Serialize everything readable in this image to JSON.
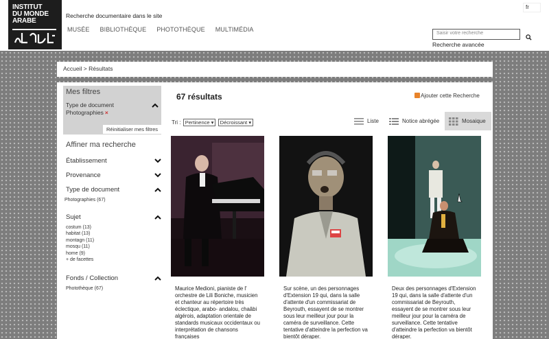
{
  "header": {
    "logo_text": "INSTITUT\nDU MONDE\nARABE",
    "tagline": "Recherche documentaire dans le site",
    "nav": [
      "MUSÉE",
      "BIBLIOTHÈQUE",
      "PHOTOTHÈQUE",
      "MULTIMÉDIA"
    ],
    "lang": "fr",
    "search_placeholder": "Saisir votre recherche",
    "advanced_search": "Recherche avancée"
  },
  "breadcrumb": "Accueil > Résultats",
  "sidebar": {
    "filters_title": "Mes filtres",
    "active_filter_label": "Type de document",
    "active_filter_value": "Photographies",
    "remove_symbol": "×",
    "reset_label": "Réinitialiser mes filtres",
    "refine_title": "Affiner ma recherche",
    "facets": {
      "etablissement": "Établissement",
      "provenance": "Provenance",
      "type_document": "Type de document",
      "type_items": [
        "Photographies (67)"
      ],
      "sujet": "Sujet",
      "sujet_items": [
        "costum (13)",
        "habitat (13)",
        "montagn (11)",
        "mosqu (11)",
        "home (9)",
        "+ de facettes"
      ],
      "fonds": "Fonds / Collection",
      "fonds_items": [
        "Photothèque (67)"
      ]
    }
  },
  "results": {
    "count_label": "67 résultats",
    "rss_label": "Ajouter cette Recherche",
    "sort_label": "Tri :",
    "sort_field": "Pertinence",
    "sort_order": "Décroissant",
    "view_list": "Liste",
    "view_short": "Notice abrégée",
    "view_mosaic": "Mosaique"
  },
  "cards": [
    {
      "icon": "pianist-photo",
      "caption": "Maurice Medioni, pianiste de l' orchestre de Lili Boniche, musicien et chanteur au répertoire très éclectique, arabo- andalou, chaâbi algérois, adaptation orientale de standards musicaux occidentaux ou interprétation de chansons françaises"
    },
    {
      "icon": "actor-photo",
      "caption": "Sur scène, un des personnages d'Extension 19 qui, dans la salle d'attente d'un commissariat de Beyrouth, essayent de se montrer sous leur meilleur jour pour la caméra de surveillance. Cette tentative d'atteindre la perfection va bientôt déraper."
    },
    {
      "icon": "stage-photo",
      "caption": "Deux des personnages d'Extension 19 qui, dans la salle d'attente d'un commissariat de Beyrouth, essayent de se montrer sous leur meilleur jour pour la caméra de surveillance. Cette tentative d'atteindre la perfection va bientôt déraper."
    }
  ]
}
